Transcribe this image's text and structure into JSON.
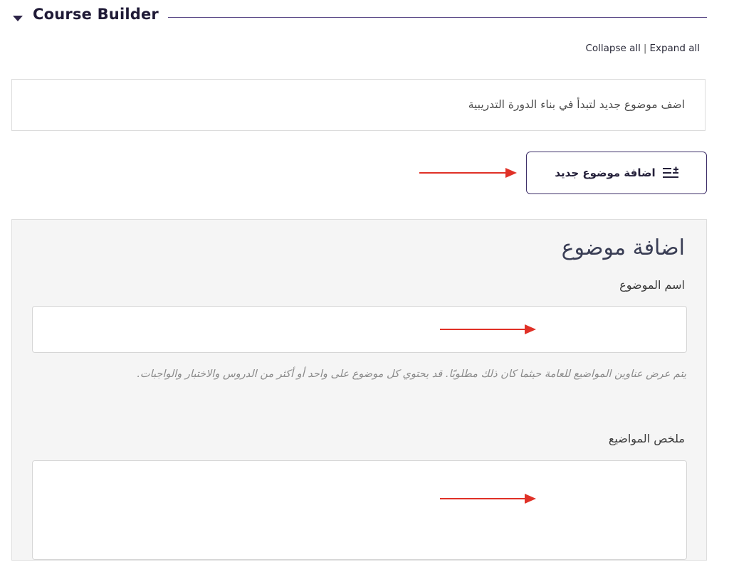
{
  "header": {
    "title": "Course Builder",
    "collapse_all": "Collapse all",
    "separator": "|",
    "expand_all": "Expand all"
  },
  "intro": {
    "text": "اضف موضوع جديد لتبدأ في بناء الدورة التدريبية"
  },
  "add_topic_button": {
    "label": "اضافة موضوع جديد",
    "icon": "list-add-icon"
  },
  "topic_form": {
    "heading": "اضافة موضوع",
    "name_label": "اسم الموضوع",
    "name_value": "",
    "help_text": "يتم عرض عناوين المواضيع للعامة حيثما كان ذلك مطلوبًا. قد يحتوي كل موضوع على واحد أو أكثر من الدروس والاختبار والواجبات.",
    "summary_label": "ملخص المواضيع",
    "summary_value": ""
  },
  "colors": {
    "accent": "#40316a",
    "annotation_arrow": "#e03127",
    "panel_bg": "#f5f5f5"
  }
}
